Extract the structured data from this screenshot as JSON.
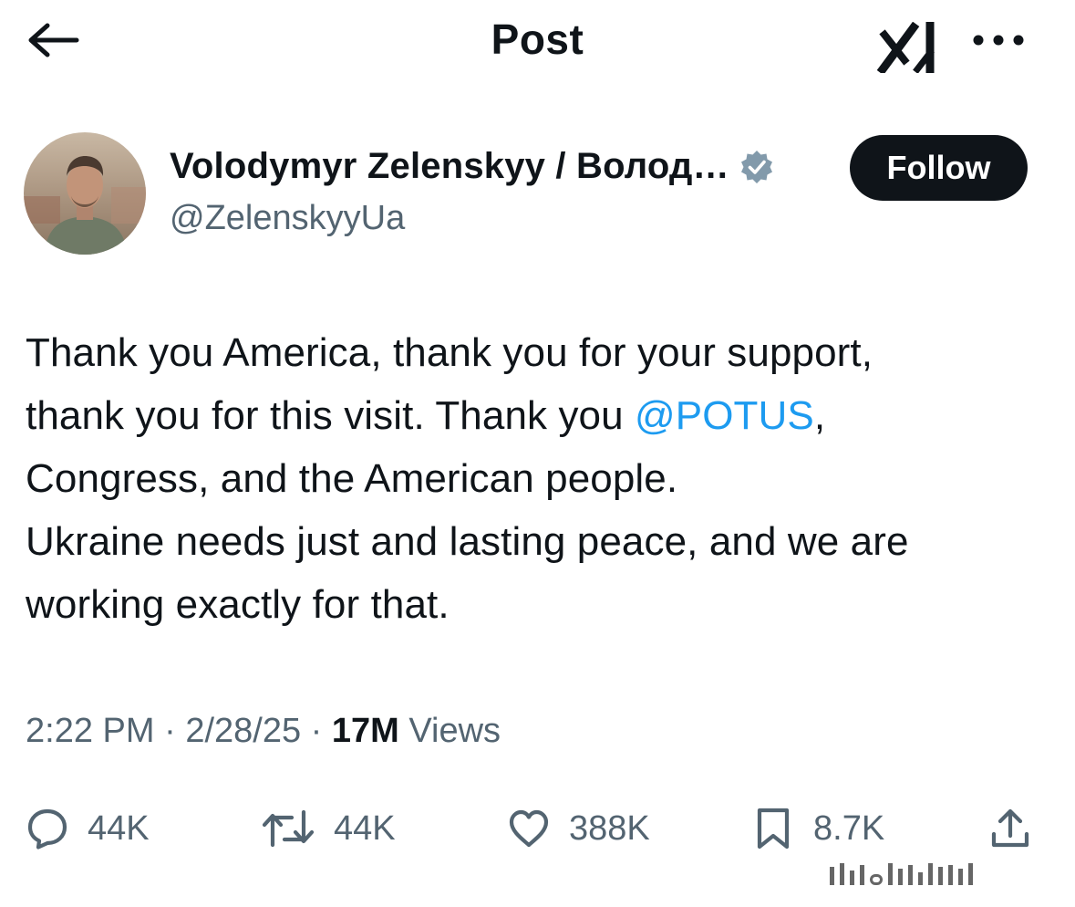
{
  "header": {
    "title": "Post",
    "back_icon": "arrow-left-icon",
    "logo_icon": "grok-logo-icon",
    "more_icon": "ellipsis-icon"
  },
  "author": {
    "display_name": "Volodymyr Zelenskyy / Волод…",
    "handle": "@ZelenskyyUa",
    "verified_icon": "verified-badge-icon",
    "follow_label": "Follow"
  },
  "post": {
    "lines": [
      {
        "text": "Thank you America, thank you for your support,"
      },
      {
        "before": "thank you for this visit. Thank you ",
        "mention": "@POTUS",
        "after": ","
      },
      {
        "text": "Congress, and the American people."
      },
      {
        "text": "Ukraine needs just and lasting peace, and we are"
      },
      {
        "text": "working exactly for that."
      }
    ]
  },
  "meta": {
    "time": "2:22 PM",
    "sep1": " · ",
    "date": "2/28/25",
    "sep2": " · ",
    "views_count": "17M",
    "views_label": " Views"
  },
  "actions": {
    "replies": "44K",
    "reposts": "44K",
    "likes": "388K",
    "bookmarks": "8.7K"
  },
  "colors": {
    "text": "#0f1419",
    "secondary": "#536471",
    "mention": "#1d9bf0",
    "button_bg": "#0f1419",
    "verified": "#829aab"
  }
}
